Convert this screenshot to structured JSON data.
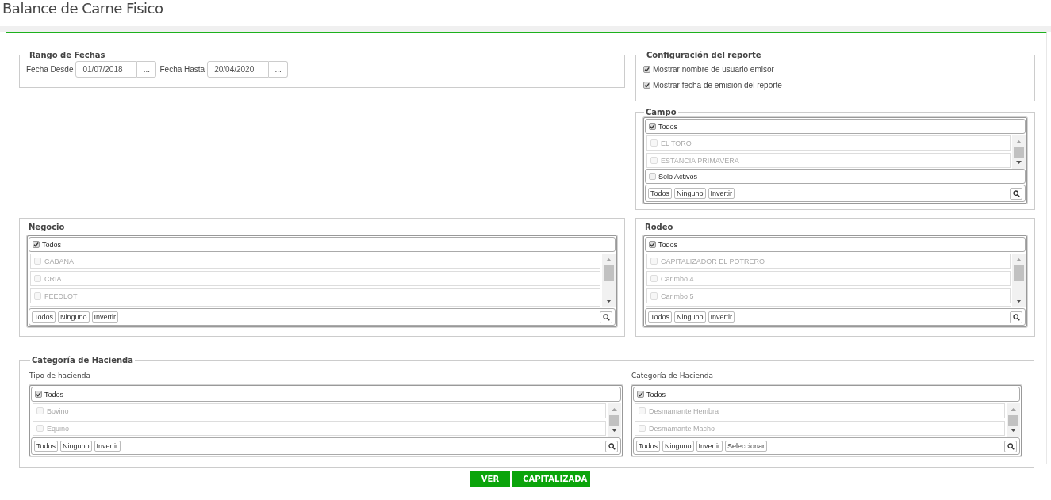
{
  "page": {
    "title": "Balance de Carne Fisico"
  },
  "date_range": {
    "legend": "Rango de Fechas",
    "fields": [
      {
        "label": "Fecha Desde",
        "value": "01/07/2018",
        "button": "..."
      },
      {
        "label": "Fecha Hasta",
        "value": "20/04/2020",
        "button": "..."
      }
    ]
  },
  "report_config": {
    "legend": "Configuración del reporte",
    "options": [
      {
        "label": "Mostrar nombre de usuario emisor",
        "checked": true
      },
      {
        "label": "Mostrar fecha de emisión del reporte",
        "checked": true
      }
    ]
  },
  "campo": {
    "legend": "Campo",
    "list": {
      "all": {
        "label": "Todos",
        "checked": true
      },
      "items": [
        {
          "label": "EL TORO",
          "checked": false,
          "disabled": true
        },
        {
          "label": "ESTANCIA PRIMAVERA",
          "checked": false,
          "disabled": true
        }
      ],
      "extra": {
        "label": "Solo Activos",
        "checked": false
      },
      "actions": [
        "Todos",
        "Ninguno",
        "Invertir"
      ]
    }
  },
  "negocio": {
    "title": "Negocio",
    "list": {
      "all": {
        "label": "Todos",
        "checked": true
      },
      "items": [
        {
          "label": "CABAÑA",
          "checked": false,
          "disabled": true
        },
        {
          "label": "CRIA",
          "checked": false,
          "disabled": true
        },
        {
          "label": "FEEDLOT",
          "checked": false,
          "disabled": true
        }
      ],
      "actions": [
        "Todos",
        "Ninguno",
        "Invertir"
      ]
    }
  },
  "rodeo": {
    "title": "Rodeo",
    "list": {
      "all": {
        "label": "Todos",
        "checked": true
      },
      "items": [
        {
          "label": "CAPITALIZADOR EL POTRERO",
          "checked": false,
          "disabled": true
        },
        {
          "label": "Carimbo 4",
          "checked": false,
          "disabled": true
        },
        {
          "label": "Carimbo 5",
          "checked": false,
          "disabled": true
        }
      ],
      "actions": [
        "Todos",
        "Ninguno",
        "Invertir"
      ]
    }
  },
  "hacienda": {
    "legend": "Categoría de Hacienda",
    "lists": [
      {
        "label": "Tipo de hacienda",
        "list": {
          "all": {
            "label": "Todos",
            "checked": true
          },
          "items": [
            {
              "label": "Bovino",
              "checked": false,
              "disabled": true
            },
            {
              "label": "Equino",
              "checked": false,
              "disabled": true
            }
          ],
          "actions": [
            "Todos",
            "Ninguno",
            "Invertir"
          ]
        }
      },
      {
        "label": "Categoría de Hacienda",
        "list": {
          "all": {
            "label": "Todos",
            "checked": true
          },
          "items": [
            {
              "label": "Desmamante Hembra",
              "checked": false,
              "disabled": true
            },
            {
              "label": "Desmamante Macho",
              "checked": false,
              "disabled": true
            }
          ],
          "actions": [
            "Todos",
            "Ninguno",
            "Invertir",
            "Seleccionar"
          ]
        }
      }
    ]
  },
  "actions": [
    "VER",
    "CAPITALIZADA"
  ]
}
